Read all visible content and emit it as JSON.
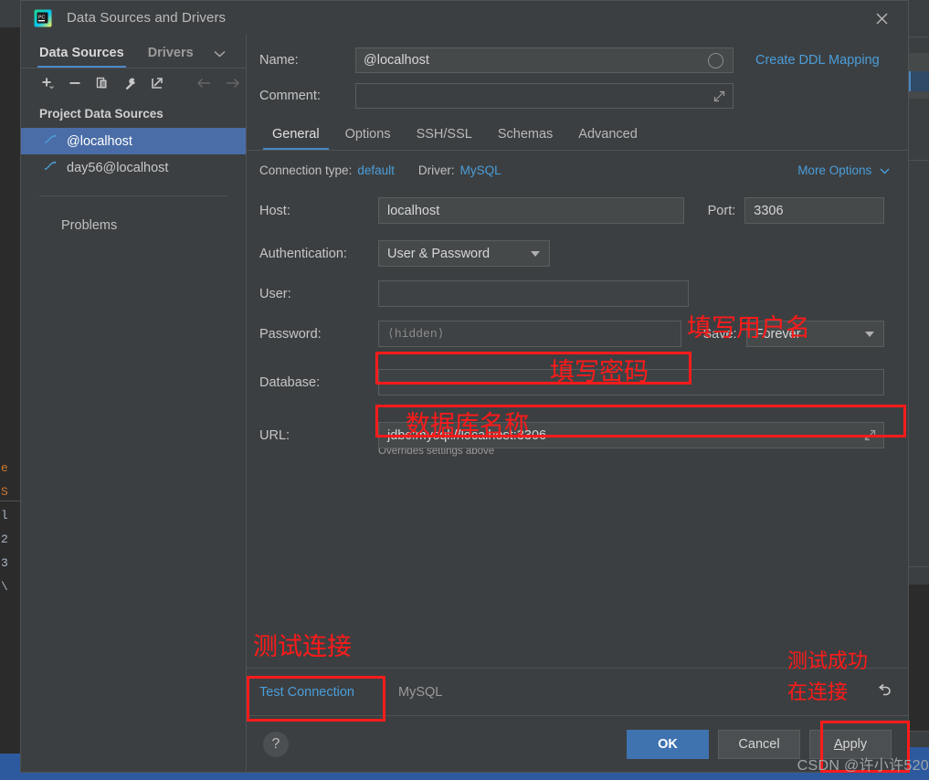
{
  "window": {
    "title": "Data Sources and Drivers",
    "app_icon": "pycharm-icon",
    "close_icon": "close-icon"
  },
  "sidebar": {
    "tabs": [
      {
        "label": "Data Sources",
        "active": true
      },
      {
        "label": "Drivers",
        "active": false
      }
    ],
    "chevron_icon": "chevron-down-icon",
    "toolbar": [
      {
        "icon": "add-icon",
        "label": "+"
      },
      {
        "icon": "remove-icon",
        "label": "−"
      },
      {
        "icon": "copy-icon",
        "label": "copy"
      },
      {
        "icon": "wrench-icon",
        "label": "wrench"
      },
      {
        "icon": "external-link-icon",
        "label": "export"
      },
      {
        "icon": "arrow-left-icon",
        "label": "back"
      },
      {
        "icon": "arrow-right-icon",
        "label": "forward"
      }
    ],
    "group_title": "Project Data Sources",
    "items": [
      {
        "label": "@localhost",
        "icon": "mysql-dolphin-icon",
        "selected": true
      },
      {
        "label": "day56@localhost",
        "icon": "mysql-dolphin-icon",
        "selected": false
      }
    ],
    "problems_label": "Problems"
  },
  "form": {
    "name_label": "Name:",
    "name_value": "@localhost",
    "name_badge_icon": "circle-icon",
    "comment_label": "Comment:",
    "comment_value": "",
    "comment_expand_icon": "expand-icon",
    "create_ddl_link": "Create DDL Mapping"
  },
  "tabs": [
    {
      "label": "General",
      "active": true
    },
    {
      "label": "Options",
      "active": false
    },
    {
      "label": "SSH/SSL",
      "active": false
    },
    {
      "label": "Schemas",
      "active": false
    },
    {
      "label": "Advanced",
      "active": false
    }
  ],
  "connection": {
    "type_label": "Connection type:",
    "type_value": "default",
    "driver_label": "Driver:",
    "driver_value": "MySQL",
    "more_options": "More Options",
    "more_options_icon": "chevron-down-icon"
  },
  "general": {
    "host_label": "Host:",
    "host_value": "localhost",
    "port_label": "Port:",
    "port_value": "3306",
    "auth_label": "Authentication:",
    "auth_value": "User & Password",
    "user_label": "User:",
    "user_value": "",
    "password_label": "Password:",
    "password_placeholder": "⟨hidden⟩",
    "save_label": "Save:",
    "save_value": "Forever",
    "database_label": "Database:",
    "database_value": "",
    "url_label": "URL:",
    "url_value": "jdbc:mysql://localhost:3306",
    "url_expand_icon": "expand-icon",
    "url_note": "Overrides settings above"
  },
  "annotations": [
    {
      "text": "填写用户名",
      "name": "annotation-fill-username"
    },
    {
      "text": "填写密码",
      "name": "annotation-fill-password"
    },
    {
      "text": "数据库名称",
      "name": "annotation-database-name"
    },
    {
      "text": "测试连接",
      "name": "annotation-test-connection"
    },
    {
      "text": "测试成功",
      "name": "annotation-test-success-1"
    },
    {
      "text": "在连接",
      "name": "annotation-test-success-2"
    }
  ],
  "footer": {
    "test_connection": "Test Connection",
    "driver_name": "MySQL",
    "undo_icon": "undo-icon",
    "help_label": "?",
    "ok": "OK",
    "cancel": "Cancel",
    "apply": "Apply",
    "apply_mnemonic": "A",
    "apply_rest": "pply"
  },
  "watermark": "CSDN @许小许520",
  "colors": {
    "accent_blue": "#4a9eda",
    "selection_blue": "#4a6da7",
    "annotation_red": "#ff1a1a",
    "panel_bg": "#3c3f41",
    "input_bg": "#45494a"
  }
}
